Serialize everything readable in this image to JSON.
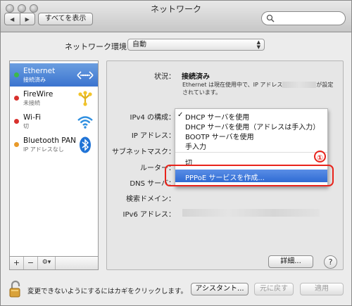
{
  "window": {
    "title": "ネットワーク"
  },
  "toolbar": {
    "back": "◀",
    "forward": "▶",
    "show_all": "すべてを表示",
    "search_placeholder": ""
  },
  "location": {
    "label": "ネットワーク環境：",
    "value": "自動"
  },
  "services": [
    {
      "name": "Ethernet",
      "status": "接続済み",
      "dot": "#3cb94a",
      "icon": "ethernet-icon",
      "selected": true
    },
    {
      "name": "FireWire",
      "status": "未接続",
      "dot": "#d8312d",
      "icon": "firewire-icon",
      "selected": false
    },
    {
      "name": "Wi-Fi",
      "status": "切",
      "dot": "#d8312d",
      "icon": "wifi-icon",
      "selected": false
    },
    {
      "name": "Bluetooth PAN",
      "status": "IP アドレスなし",
      "dot": "#e89a2a",
      "icon": "bluetooth-icon",
      "selected": false
    }
  ],
  "sidebar_toolbar": {
    "add": "+",
    "remove": "−",
    "gear": "⚙▾"
  },
  "detail": {
    "status_label": "状況：",
    "status_value": "接続済み",
    "status_desc_prefix": "Ethernet は現在使用中で、IP アドレス",
    "status_desc_suffix": "が設定されています。",
    "ipv4_label": "IPv4 の構成：",
    "ip_label": "IP アドレス：",
    "subnet_label": "サブネットマスク：",
    "router_label": "ルーター：",
    "dns_label": "DNS サーバ：",
    "search_domain_label": "検索ドメイン：",
    "ipv6_label": "IPv6 アドレス："
  },
  "menu": {
    "checkmark": "✓",
    "items": [
      "DHCP サーバを使用",
      "DHCP サーバを使用（アドレスは手入力）",
      "BOOTP サーバを使用",
      "手入力",
      "切",
      "PPPoE サービスを作成..."
    ]
  },
  "annotation": {
    "marker": "①",
    "color": "#e8241c"
  },
  "buttons": {
    "advanced": "詳細...",
    "help": "?",
    "assistant": "アシスタント...",
    "revert": "元に戻す",
    "apply": "適用"
  },
  "lock": {
    "text": "変更できないようにするにはカギをクリックします。"
  },
  "colors": {
    "selection": "#3b74cf",
    "highlight": "#2f6bd3"
  }
}
